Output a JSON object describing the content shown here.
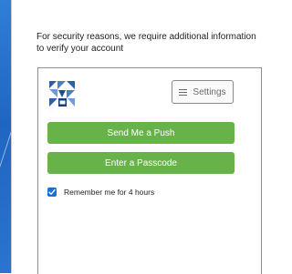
{
  "dialog": {
    "message": "For security reasons, we require additional information to verify your account"
  },
  "panel": {
    "logo_icon": "duo-logo-icon",
    "settings_label": "Settings",
    "settings_icon": "hamburger-menu-icon",
    "push_label": "Send Me a Push",
    "passcode_label": "Enter a Passcode",
    "remember_label": "Remember me for 4 hours",
    "remember_checked": true
  },
  "colors": {
    "accent_green": "#67b34a",
    "checkbox_blue": "#1a6fd1",
    "background_blue": "#2f7ed8",
    "logo_blue": "#2d5fa8"
  }
}
